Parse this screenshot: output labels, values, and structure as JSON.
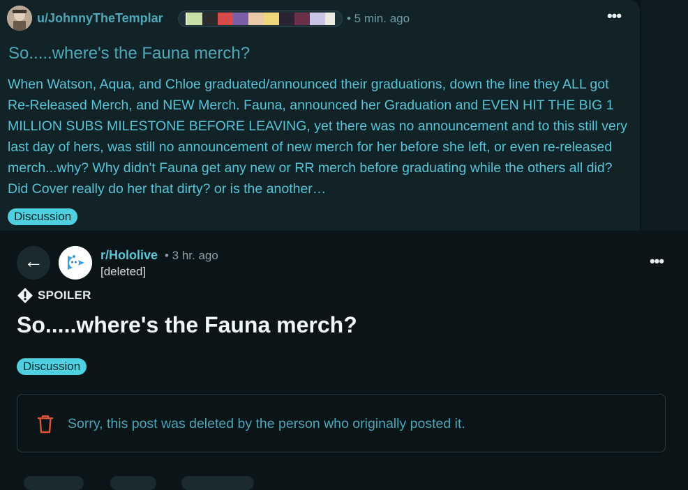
{
  "archived_post": {
    "author": "u/JohnnyTheTemplar",
    "time": "• 5 min. ago",
    "more_label": "•••",
    "title": "So.....where's the Fauna merch?",
    "body": "When Watson, Aqua, and Chloe graduated/announced their graduations, down the line they ALL got Re-Released Merch, and NEW Merch. Fauna, announced her Graduation and EVEN HIT THE BIG 1 MILLION SUBS MILESTONE BEFORE LEAVING, yet there was no announcement and to this still very last day of hers, was still no announcement of new merch for her before she left, or even re-released merch...why? Why didn't Fauna get any new or RR merch before graduating while the others all did? Did Cover really do her that dirty? or is the another…",
    "flair_tag": "Discussion"
  },
  "current_post": {
    "back_icon": "←",
    "subreddit": "r/Hololive",
    "time": "• 3 hr. ago",
    "author": "[deleted]",
    "more_label": "•••",
    "spoiler_label": "SPOILER",
    "title": "So.....where's the Fauna merch?",
    "flair_tag": "Discussion",
    "deleted_message": "Sorry, this post was deleted by the person who originally posted it."
  },
  "colors": {
    "accent": "#4fd0e0",
    "link": "#4fa7b8",
    "delete_icon": "#e0533a"
  }
}
